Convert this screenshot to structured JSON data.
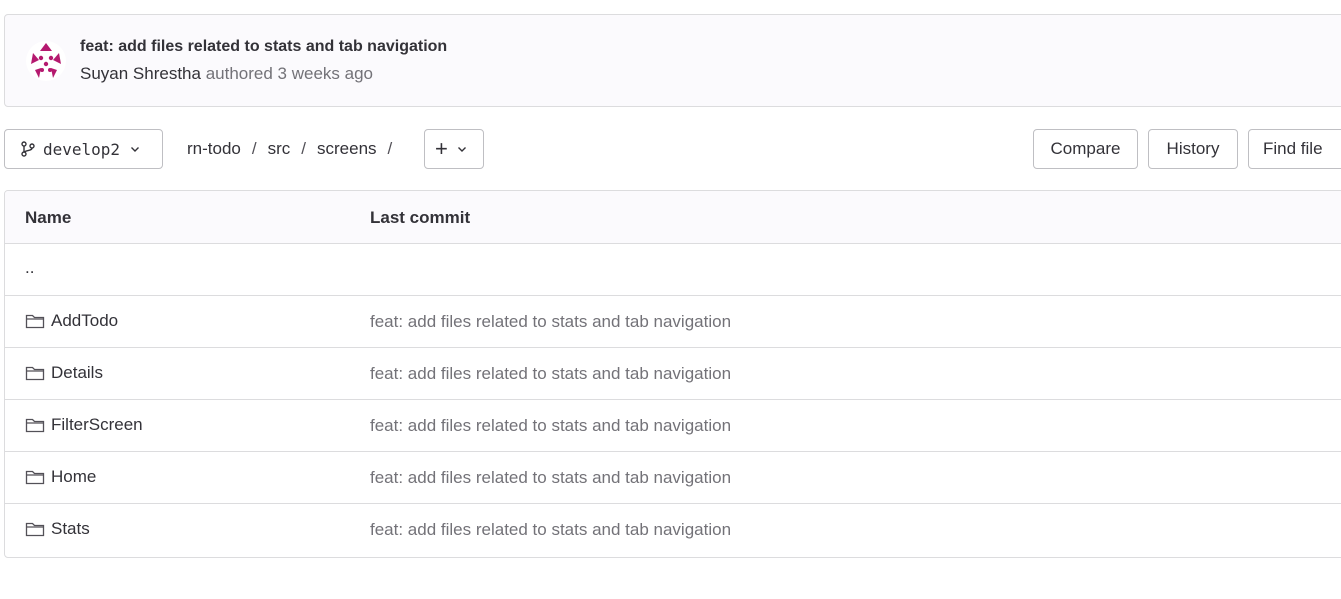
{
  "commit": {
    "title": "feat: add files related to stats and tab navigation",
    "author": "Suyan Shrestha",
    "authored_text": " authored ",
    "time": "3 weeks ago"
  },
  "toolbar": {
    "branch": "develop2",
    "breadcrumb": [
      "rn-todo",
      "src",
      "screens"
    ],
    "separator": "/",
    "add_label": "+",
    "compare_label": "Compare",
    "history_label": "History",
    "find_file_label": "Find file"
  },
  "tree": {
    "columns": {
      "name": "Name",
      "last_commit": "Last commit"
    },
    "parent": "..",
    "rows": [
      {
        "name": "AddTodo",
        "commit": "feat: add files related to stats and tab navigation"
      },
      {
        "name": "Details",
        "commit": "feat: add files related to stats and tab navigation"
      },
      {
        "name": "FilterScreen",
        "commit": "feat: add files related to stats and tab navigation"
      },
      {
        "name": "Home",
        "commit": "feat: add files related to stats and tab navigation"
      },
      {
        "name": "Stats",
        "commit": "feat: add files related to stats and tab navigation"
      }
    ]
  },
  "colors": {
    "avatar_accent": "#b5196f",
    "muted_text": "#737278",
    "border": "#dcdcde"
  }
}
